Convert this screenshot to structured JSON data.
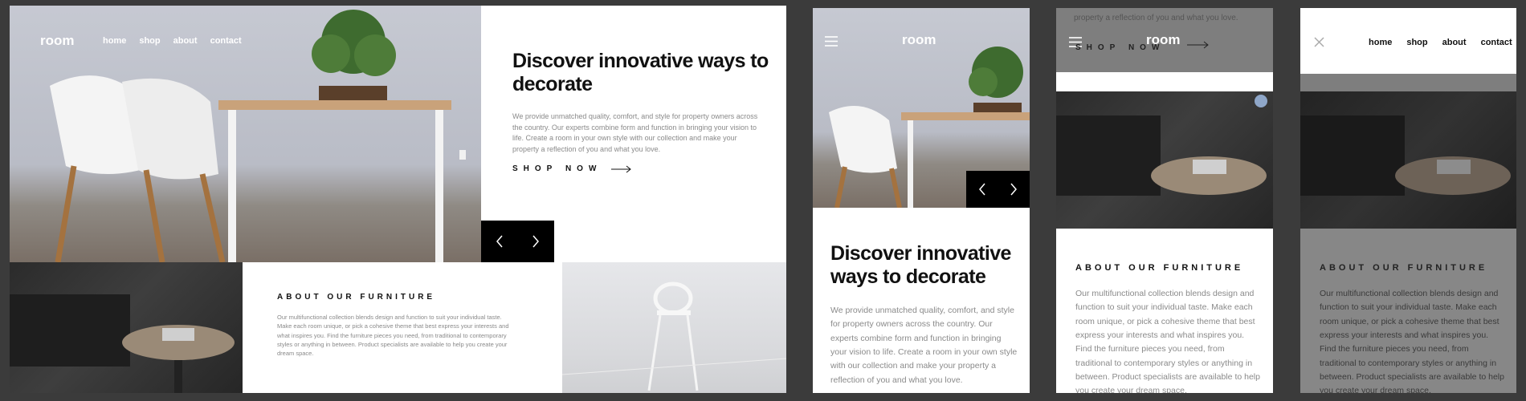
{
  "brand": {
    "logo": "room"
  },
  "nav": {
    "links": [
      "home",
      "shop",
      "about",
      "contact"
    ]
  },
  "hero": {
    "heading": "Discover innovative ways to decorate",
    "body": "We provide unmatched quality, comfort, and style for property owners across the country. Our experts combine form and function in bringing your vision to life. Create a room in your own style with our collection and make your property a reflection of you and what you love.",
    "shop_label": "SHOP NOW"
  },
  "about": {
    "title": "ABOUT OUR FURNITURE",
    "body": "Our multifunctional collection blends design and function to suit your individual taste. Make each room unique, or pick a cohesive theme that best express your interests and what inspires you. Find the furniture pieces you need, from traditional to contemporary styles or anything in between. Product specialists are available to help you create your dream space."
  },
  "mobile_menu_screen": {
    "truncated_top_text": "property a reflection of you and what you love.",
    "truncated_bottom_text": "help you create your dream space."
  },
  "colors": {
    "page_bg": "#3b3b3b",
    "accent_dark": "#000000",
    "text_muted": "#8a8a8a"
  },
  "icons": [
    "hamburger-icon",
    "close-icon",
    "arrow-left-icon",
    "arrow-right-icon",
    "long-arrow-icon"
  ]
}
